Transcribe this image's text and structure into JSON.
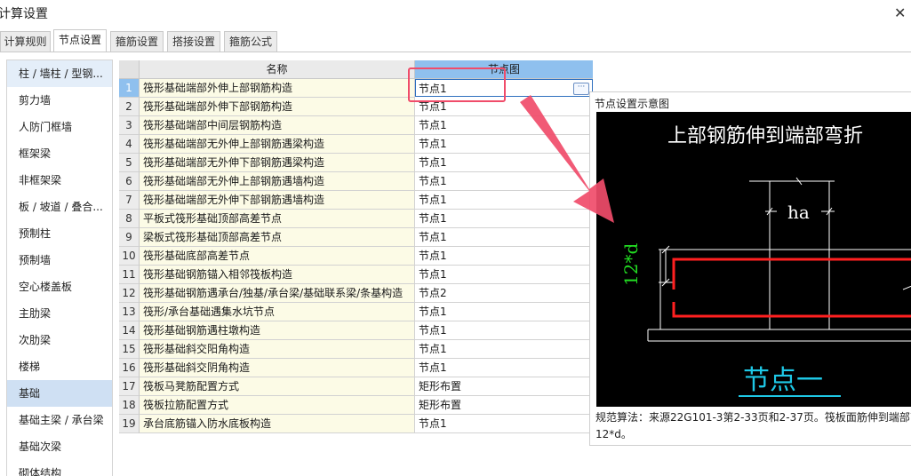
{
  "window": {
    "title": "计算设置",
    "close_label": "✕"
  },
  "tabs": [
    {
      "label": "计算规则",
      "active": false
    },
    {
      "label": "节点设置",
      "active": true
    },
    {
      "label": "箍筋设置",
      "active": false
    },
    {
      "label": "搭接设置",
      "active": false
    },
    {
      "label": "箍筋公式",
      "active": false
    }
  ],
  "sidebar": {
    "selected": "基础",
    "items": [
      {
        "label": "柱 / 墙柱 / 型钢..."
      },
      {
        "label": "剪力墙"
      },
      {
        "label": "人防门框墙"
      },
      {
        "label": "框架梁"
      },
      {
        "label": "非框架梁"
      },
      {
        "label": "板 / 坡道 / 叠合..."
      },
      {
        "label": "预制柱"
      },
      {
        "label": "预制墙"
      },
      {
        "label": "空心楼盖板"
      },
      {
        "label": "主肋梁"
      },
      {
        "label": "次肋梁"
      },
      {
        "label": "楼梯"
      },
      {
        "label": "基础"
      },
      {
        "label": "基础主梁 / 承台梁"
      },
      {
        "label": "基础次梁"
      },
      {
        "label": "砌体结构"
      }
    ]
  },
  "grid": {
    "headers": {
      "name": "名称",
      "node": "节点图"
    },
    "rows": [
      {
        "num": "1",
        "name": "筏形基础端部外伸上部钢筋构造",
        "node": "节点1"
      },
      {
        "num": "2",
        "name": "筏形基础端部外伸下部钢筋构造",
        "node": "节点1"
      },
      {
        "num": "3",
        "name": "筏形基础端部中间层钢筋构造",
        "node": "节点1"
      },
      {
        "num": "4",
        "name": "筏形基础端部无外伸上部钢筋遇梁构造",
        "node": "节点1"
      },
      {
        "num": "5",
        "name": "筏形基础端部无外伸下部钢筋遇梁构造",
        "node": "节点1"
      },
      {
        "num": "6",
        "name": "筏形基础端部无外伸上部钢筋遇墙构造",
        "node": "节点1"
      },
      {
        "num": "7",
        "name": "筏形基础端部无外伸下部钢筋遇墙构造",
        "node": "节点1"
      },
      {
        "num": "8",
        "name": "平板式筏形基础顶部高差节点",
        "node": "节点1"
      },
      {
        "num": "9",
        "name": "梁板式筏形基础顶部高差节点",
        "node": "节点1"
      },
      {
        "num": "10",
        "name": "筏形基础底部高差节点",
        "node": "节点1"
      },
      {
        "num": "11",
        "name": "筏形基础钢筋锚入相邻筏板构造",
        "node": "节点1"
      },
      {
        "num": "12",
        "name": "筏形基础钢筋遇承台/独基/承台梁/基础联系梁/条基构造",
        "node": "节点2"
      },
      {
        "num": "13",
        "name": "筏形/承台基础遇集水坑节点",
        "node": "节点1"
      },
      {
        "num": "14",
        "name": "筏形基础钢筋遇柱墩构造",
        "node": "节点1"
      },
      {
        "num": "15",
        "name": "筏形基础斜交阳角构造",
        "node": "节点1"
      },
      {
        "num": "16",
        "name": "筏形基础斜交阴角构造",
        "node": "节点1"
      },
      {
        "num": "17",
        "name": "筏板马凳筋配置方式",
        "node": "矩形布置"
      },
      {
        "num": "18",
        "name": "筏板拉筋配置方式",
        "node": "矩形布置"
      },
      {
        "num": "19",
        "name": "承台底筋锚入防水底板构造",
        "node": "节点1"
      }
    ],
    "ellipsis_label": "···"
  },
  "preview": {
    "title": "节点设置示意图",
    "diagram": {
      "heading": "上部钢筋伸到端部弯折",
      "dim_ha": "ha",
      "dim_12d": "12*d",
      "caption": "节点一",
      "colors": {
        "background": "#000000",
        "lines": "#ffffff",
        "rebar": "#ff2020",
        "green_text": "#22dd22",
        "caption": "#1ec8e6"
      }
    },
    "note_line1": "规范算法：来源22G101-3第2-33页和2-37页。筏板面筋伸到端部弯",
    "note_line2": "12*d。"
  },
  "annotation": {
    "highlight_color": "#f04c6a"
  }
}
